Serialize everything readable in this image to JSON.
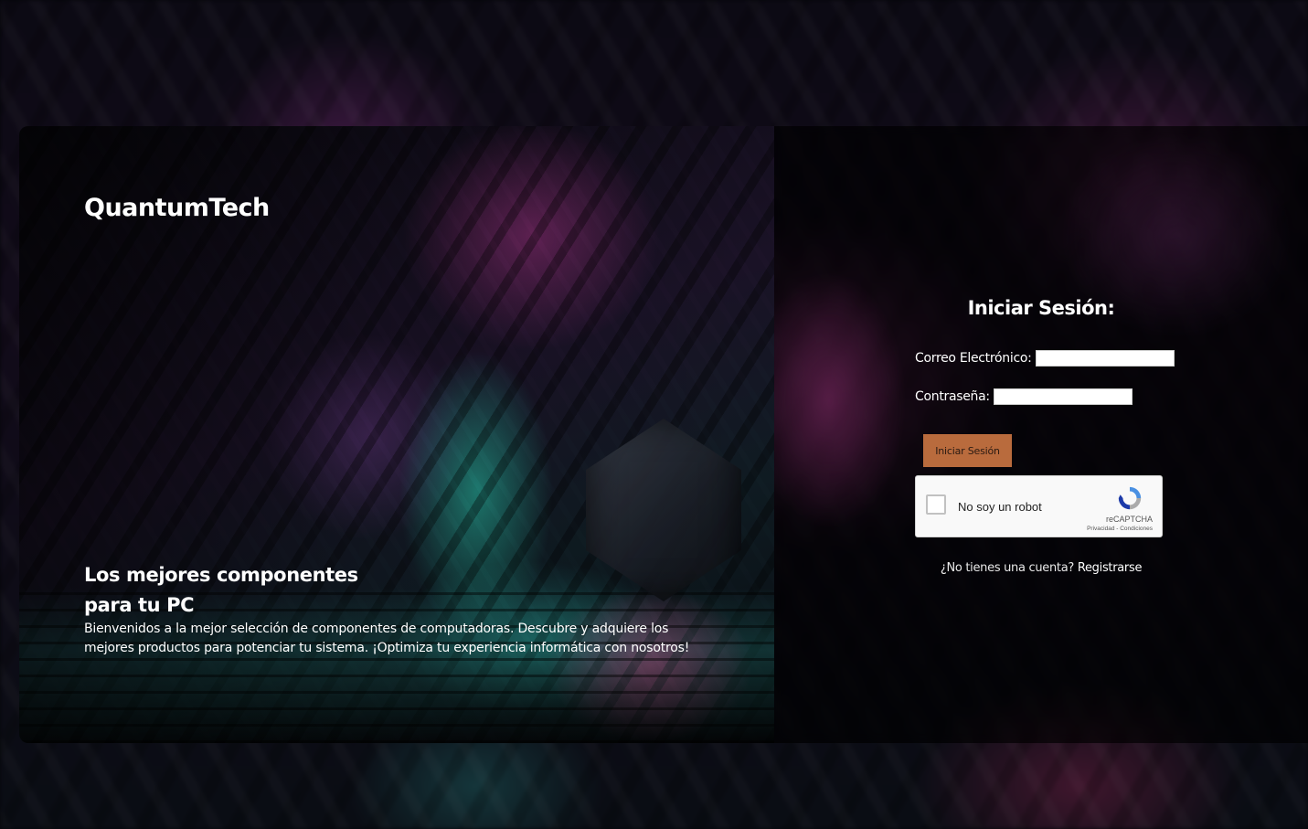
{
  "brand": {
    "name": "QuantumTech"
  },
  "hero": {
    "title": "Los mejores componentes para tu PC",
    "description": "Bienvenidos a la mejor selección de componentes de computadoras. Descubre y adquiere los mejores productos para potenciar tu sistema. ¡Optimiza tu experiencia informática con nosotros!"
  },
  "login": {
    "heading": "Iniciar Sesión:",
    "email_label": "Correo Electrónico:",
    "email_value": "",
    "password_label": "Contraseña:",
    "password_value": "",
    "submit_label": "Iniciar Sesión",
    "captcha": {
      "label": "No soy un robot",
      "brand": "reCAPTCHA",
      "links": "Privacidad - Condiciones",
      "checked": false
    },
    "register_prompt": "¿No tienes una cuenta?",
    "register_link": "Registrarse"
  },
  "colors": {
    "button_bg": "#b96b3d",
    "panel_bg": "#000000",
    "text": "#ffffff"
  },
  "icons": {
    "captcha": "recaptcha-logo-icon"
  }
}
